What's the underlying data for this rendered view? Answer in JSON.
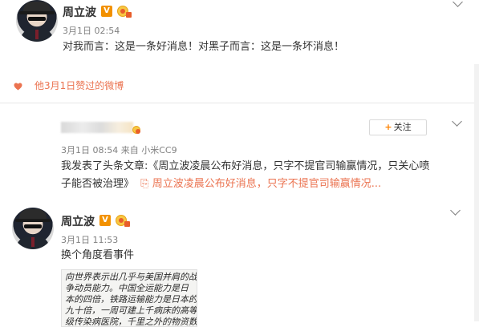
{
  "post1": {
    "username": "周立波",
    "verified_badge": "V",
    "time": "3月1日 02:54",
    "text": "对我而言：这是一条好消息！对黑子而言：这是一条坏消息！"
  },
  "like_notice": "他3月1日赞过的微博",
  "post2": {
    "follow_label": "关注",
    "time": "3月1日 08:54",
    "source_prefix": "来自",
    "source": "小米CC9",
    "text_line1": "我发表了头条文章:《周立波凌晨公布好消息，只字不提官司输赢情况，只关心喷",
    "text_line2_prefix": "子能否被治理》",
    "link_text": "周立波凌晨公布好消息，只字不提官司输赢情况..."
  },
  "post3": {
    "username": "周立波",
    "verified_badge": "V",
    "time": "3月1日 11:53",
    "text": "换个角度看事件",
    "image_lines": [
      "向世界表示出几乎与美国并肩的战",
      "争动员能力。中国全运能力是日",
      "本的四倍，铁路运输能力是日本的",
      "九十倍，一周可建上千病床的高等",
      "级传染病医院，千里之外的物资数"
    ]
  },
  "icons": {
    "like": "heart-icon",
    "menu": "chevron-down-icon",
    "verified": "verified-v-icon",
    "level": "level-badge-icon"
  },
  "colors": {
    "accent": "#eb7350",
    "verified": "#f29100",
    "follow_plus": "#ff8200"
  }
}
